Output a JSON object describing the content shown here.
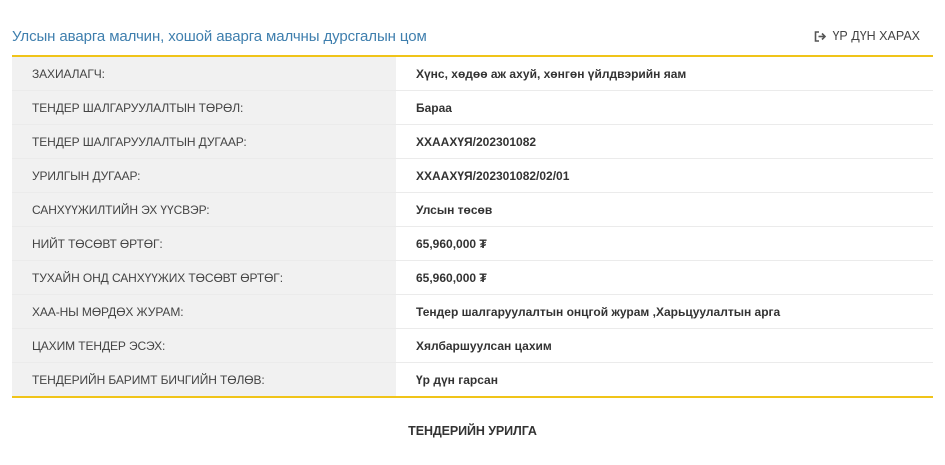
{
  "header": {
    "title": "Улсын аварга малчин, хошой аварга малчны дурсгалын цом",
    "results_link": {
      "label": "ҮР ДҮН ХАРАХ",
      "icon": "sign-out-icon"
    }
  },
  "details": [
    {
      "label": "ЗАХИАЛАГЧ:",
      "value": "Хүнс, хөдөө аж ахуй, хөнгөн үйлдвэрийн яам"
    },
    {
      "label": "ТЕНДЕР ШАЛГАРУУЛАЛТЫН ТӨРӨЛ:",
      "value": "Бараа"
    },
    {
      "label": "ТЕНДЕР ШАЛГАРУУЛАЛТЫН ДУГААР:",
      "value": "ХХААХҮЯ/202301082"
    },
    {
      "label": "УРИЛГЫН ДУГААР:",
      "value": "ХХААХҮЯ/202301082/02/01"
    },
    {
      "label": "САНХҮҮЖИЛТИЙН ЭХ ҮҮСВЭР:",
      "value": "Улсын төсөв"
    },
    {
      "label": "НИЙТ ТӨСӨВТ ӨРТӨГ:",
      "value": "65,960,000 ₮"
    },
    {
      "label": "ТУХАЙН ОНД САНХҮҮЖИХ ТӨСӨВТ ӨРТӨГ:",
      "value": "65,960,000 ₮"
    },
    {
      "label": "ХАА-НЫ МӨРДӨХ ЖУРАМ:",
      "value": "Тендер шалгаруулалтын онцгой журам ,Харьцуулалтын арга"
    },
    {
      "label": "ЦАХИМ ТЕНДЕР ЭСЭХ:",
      "value": "Хялбаршуулсан цахим"
    },
    {
      "label": "ТЕНДЕРИЙН БАРИМТ БИЧГИЙН ТӨЛӨВ:",
      "value": "Үр дүн гарсан"
    }
  ],
  "section": {
    "heading": "ТЕНДЕРИЙН УРИЛГА"
  },
  "colors": {
    "title": "#3f7fae",
    "accent_border": "#f0c419",
    "label_background": "#f1f1f1",
    "row_divider": "#ebebeb"
  }
}
